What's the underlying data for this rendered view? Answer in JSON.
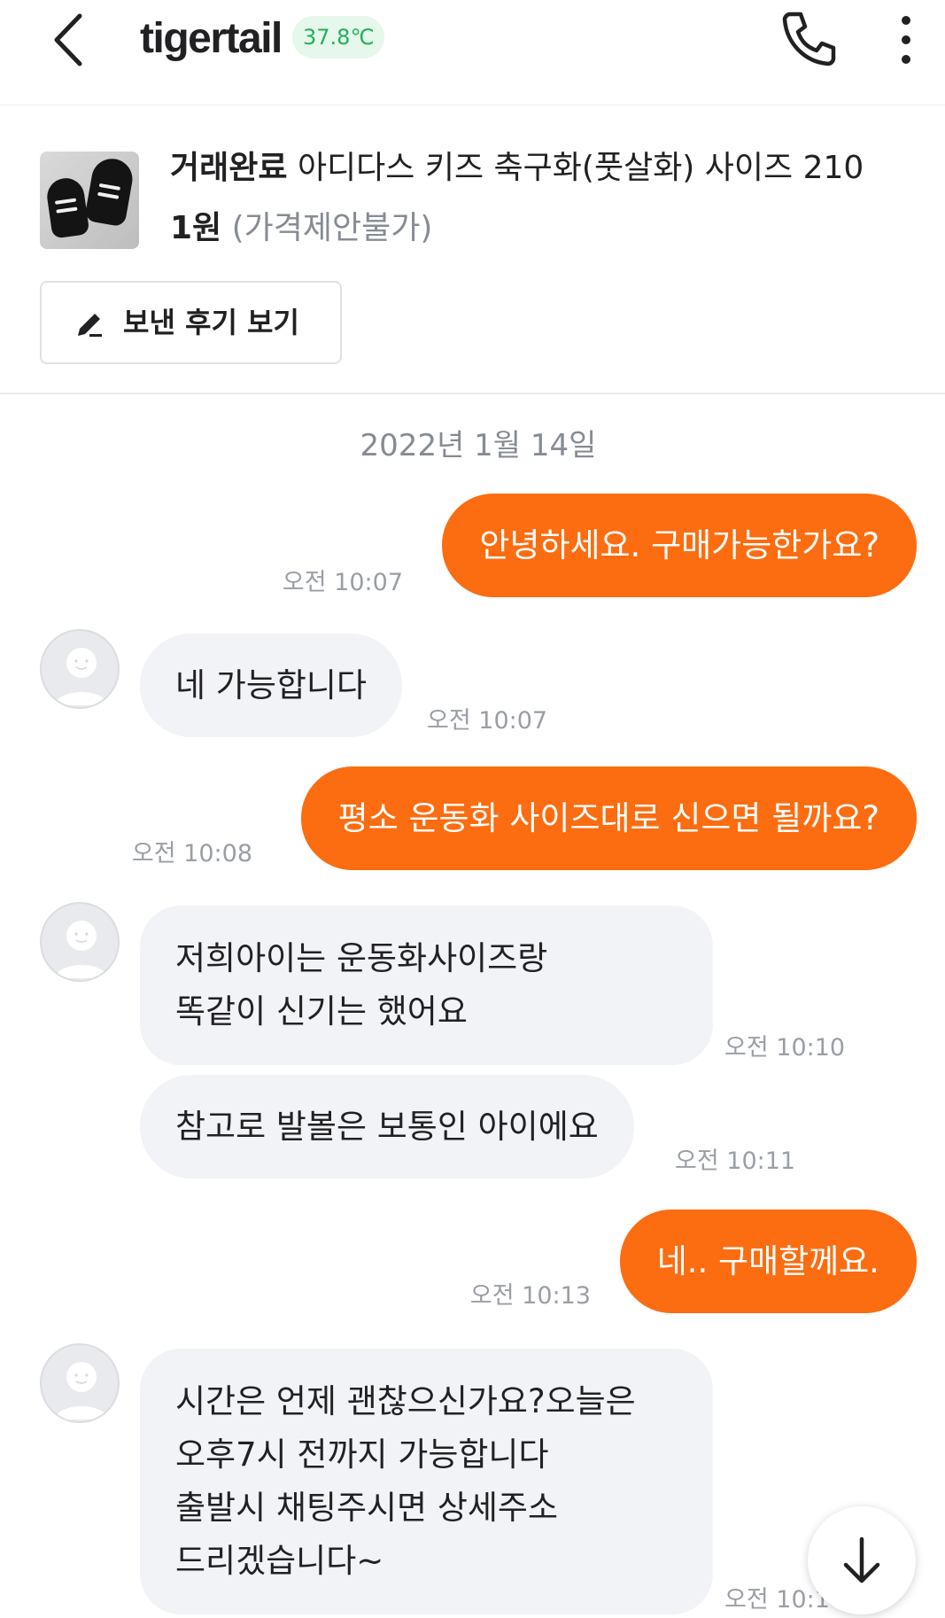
{
  "header": {
    "nickname": "tigertail",
    "temperature": "37.8℃",
    "temperature_color": "#23b05a",
    "icons": [
      "back-arrow-icon",
      "phone-icon",
      "more-vertical-icon"
    ]
  },
  "product": {
    "status": "거래완료",
    "title": "아디다스 키즈 축구화(풋살화) 사이즈 210",
    "price": "1원",
    "price_note": "(가격제안불가)",
    "review_button_label": "보낸 후기 보기"
  },
  "chat": {
    "date": "2022년 1월 14일",
    "accent_color": "#fb6d10",
    "messages": [
      {
        "sender": "me",
        "lines": [
          "안녕하세요. 구매가능한가요?"
        ],
        "time": "오전 10:07"
      },
      {
        "sender": "other",
        "lines": [
          "네 가능합니다"
        ],
        "time": "오전 10:07"
      },
      {
        "sender": "me",
        "lines": [
          "평소 운동화 사이즈대로 신으면 될까요?"
        ],
        "time": "오전 10:08"
      },
      {
        "sender": "other",
        "lines": [
          "저희아이는 운동화사이즈랑",
          "똑같이 신기는 했어요"
        ],
        "time": "오전 10:10"
      },
      {
        "sender": "other",
        "lines": [
          "참고로 발볼은 보통인 아이에요"
        ],
        "time": "오전 10:11"
      },
      {
        "sender": "me",
        "lines": [
          "네.. 구매할께요."
        ],
        "time": "오전 10:13"
      },
      {
        "sender": "other",
        "lines": [
          "시간은 언제 괜찮으신가요?오늘은",
          "오후7시 전까지 가능합니다",
          "출발시 채팅주시면 상세주소",
          "드리겠습니다~"
        ],
        "time": "오전 10:14"
      }
    ]
  }
}
